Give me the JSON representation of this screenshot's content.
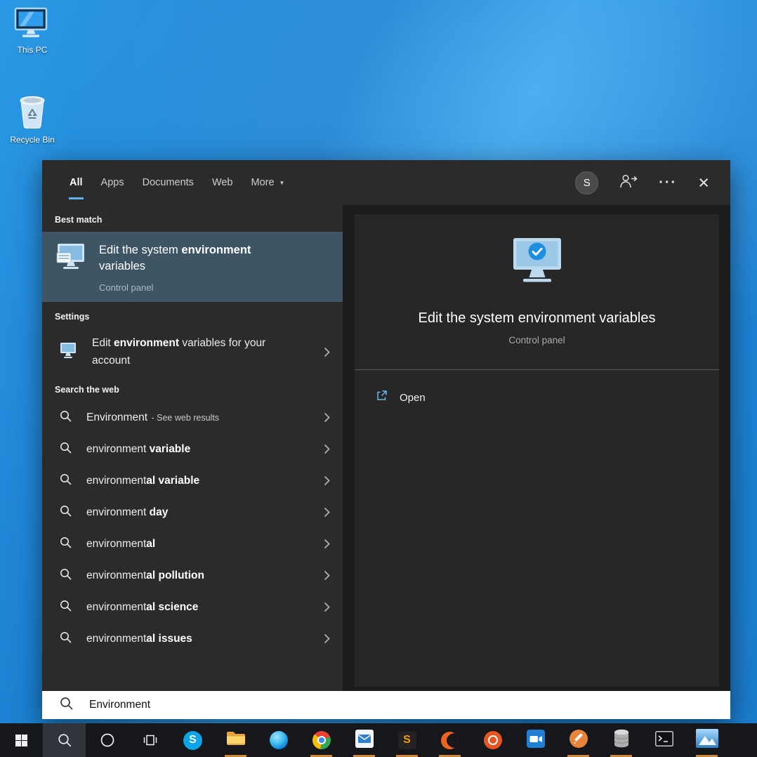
{
  "desktop": {
    "icons": [
      {
        "label": "This PC"
      },
      {
        "label": "Recycle Bin"
      }
    ]
  },
  "icons": {
    "close_glyph": "×",
    "ellipsis_glyph": "···",
    "dropdown_glyph": "▼"
  },
  "search_panel": {
    "tabs": [
      {
        "label": "All",
        "active": true
      },
      {
        "label": "Apps",
        "active": false
      },
      {
        "label": "Documents",
        "active": false
      },
      {
        "label": "Web",
        "active": false
      },
      {
        "label": "More",
        "active": false
      }
    ],
    "avatar_letter": "S",
    "section_best_match": "Best match",
    "best_match": {
      "title_pre": "Edit the system ",
      "title_bold": "environment",
      "title_post": " variables",
      "subtitle": "Control panel"
    },
    "section_settings": "Settings",
    "settings_item": {
      "pre": "Edit ",
      "bold": "environment",
      "post": " variables for your account"
    },
    "section_web": "Search the web",
    "web_items": [
      {
        "pre": "Environment",
        "bold": "",
        "suffix": " - See web results"
      },
      {
        "pre": "environment ",
        "bold": "variable"
      },
      {
        "pre": "environment",
        "bold": "al variable"
      },
      {
        "pre": "environment ",
        "bold": "day"
      },
      {
        "pre": "environment",
        "bold": "al"
      },
      {
        "pre": "environment",
        "bold": "al pollution"
      },
      {
        "pre": "environment",
        "bold": "al science"
      },
      {
        "pre": "environment",
        "bold": "al issues"
      }
    ],
    "preview": {
      "title": "Edit the system environment variables",
      "subtitle": "Control panel",
      "open_label": "Open"
    },
    "search_input": {
      "value": "Environment"
    }
  },
  "taskbar": {
    "skype_letter": "S",
    "sublime_letter": "S",
    "accent_indicator": "#d0873a",
    "items": [
      {
        "name": "start-button",
        "running": false
      },
      {
        "name": "search-button",
        "running": false,
        "active": true
      },
      {
        "name": "cortana-button",
        "running": false
      },
      {
        "name": "task-view-button",
        "running": false
      },
      {
        "name": "skype",
        "running": false
      },
      {
        "name": "file-explorer",
        "running": true
      },
      {
        "name": "edge-browser",
        "running": false
      },
      {
        "name": "chrome-browser",
        "running": true
      },
      {
        "name": "mail-app",
        "running": true
      },
      {
        "name": "sublime-text",
        "running": true
      },
      {
        "name": "crescent-app",
        "running": true
      },
      {
        "name": "ubuntu",
        "running": false
      },
      {
        "name": "camera-app",
        "running": false
      },
      {
        "name": "pen-app",
        "running": true
      },
      {
        "name": "database-app",
        "running": true
      },
      {
        "name": "terminal",
        "running": false
      },
      {
        "name": "photos-app",
        "running": true
      }
    ]
  },
  "colors": {
    "accent_underline": "#5fb4f0",
    "best_match_bg": "#3e5565",
    "desktop_blue": "#1f87dc",
    "taskbar_bg": "#15171b"
  }
}
